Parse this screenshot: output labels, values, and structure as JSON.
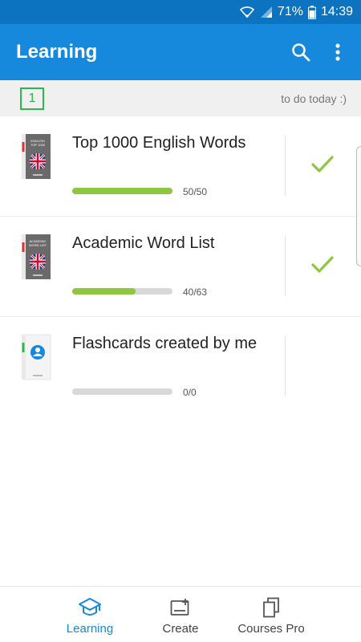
{
  "status_bar": {
    "battery": "71%",
    "time": "14:39",
    "icons": [
      "wifi-icon",
      "signal-icon",
      "battery-icon"
    ]
  },
  "app_bar": {
    "title": "Learning",
    "icons": [
      "search-icon",
      "more-vert-icon"
    ]
  },
  "todo": {
    "count": "1",
    "text": "to do today :)"
  },
  "courses": [
    {
      "name": "Top 1000 English Words",
      "progress_text": "50/50",
      "progress": 1.0,
      "completed": true,
      "cover_icon": "uk-flag-book-icon",
      "cover_line1": "ENGLISH",
      "cover_line2": "TOP 1000"
    },
    {
      "name": "Academic Word List",
      "progress_text": "40/63",
      "progress": 0.635,
      "completed": true,
      "cover_icon": "uk-flag-book-icon",
      "cover_line1": "ACADEMIC",
      "cover_line2": "WORD LIST"
    },
    {
      "name": "Flashcards created by me",
      "progress_text": "0/0",
      "progress": 0,
      "completed": false,
      "cover_icon": "user-book-icon"
    }
  ],
  "bottom_nav": [
    {
      "label": "Learning",
      "icon": "graduation-cap-icon",
      "active": true
    },
    {
      "label": "Create",
      "icon": "create-card-icon",
      "active": false
    },
    {
      "label": "Courses Pro",
      "icon": "courses-stack-icon",
      "active": false
    }
  ],
  "colors": {
    "status_bar": "#0c73c0",
    "app_bar": "#1689dc",
    "accent_green": "#8dc63f",
    "count_green": "#2db84a",
    "active_nav": "#1689dc"
  }
}
